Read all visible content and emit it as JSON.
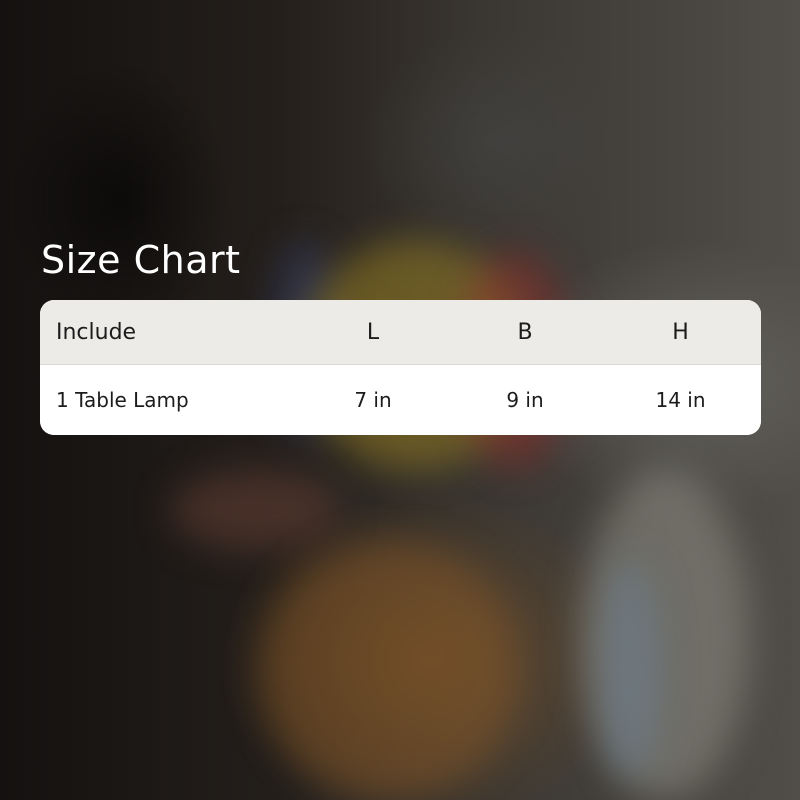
{
  "title": "Size Chart",
  "table": {
    "headers": [
      "Include",
      "L",
      "B",
      "H"
    ],
    "rows": [
      [
        "1 Table Lamp",
        "7 in",
        "9 in",
        "14 in"
      ]
    ]
  }
}
